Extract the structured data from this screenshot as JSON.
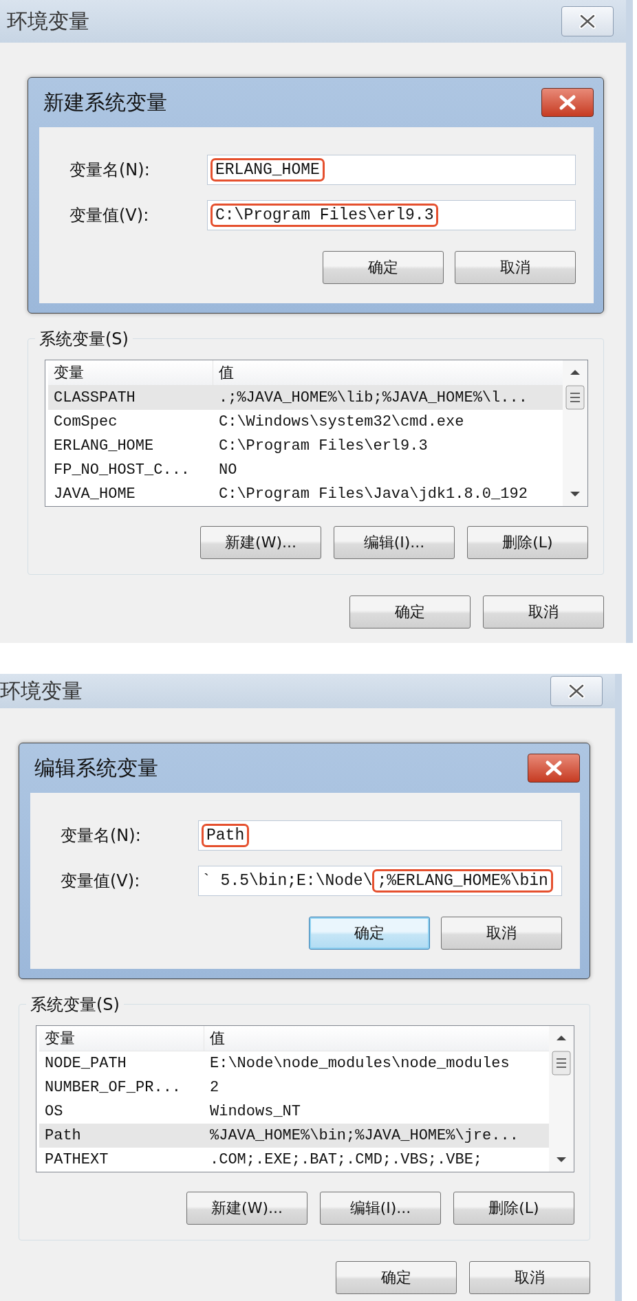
{
  "panels": [
    {
      "window": {
        "title": "环境变量"
      },
      "dialog": {
        "title": "新建系统变量",
        "fields": [
          {
            "label": "变量名(N):",
            "segments": [
              {
                "text": "ERLANG_HOME",
                "highlighted": true
              }
            ]
          },
          {
            "label": "变量值(V):",
            "segments": [
              {
                "text": "C:\\Program Files\\erl9.3",
                "highlighted": true
              }
            ]
          }
        ],
        "buttons": [
          {
            "label": "确定",
            "default": false
          },
          {
            "label": "取消",
            "default": false
          }
        ]
      },
      "system_variables": {
        "title": "系统变量(S)",
        "columns": [
          "变量",
          "值"
        ],
        "rows": [
          {
            "name": "CLASSPATH",
            "value": ".;%JAVA_HOME%\\lib;%JAVA_HOME%\\l...",
            "selected": true
          },
          {
            "name": "ComSpec",
            "value": "C:\\Windows\\system32\\cmd.exe",
            "selected": false
          },
          {
            "name": "ERLANG_HOME",
            "value": "C:\\Program Files\\erl9.3",
            "selected": false
          },
          {
            "name": "FP_NO_HOST_C...",
            "value": "NO",
            "selected": false
          },
          {
            "name": "JAVA_HOME",
            "value": "C:\\Program Files\\Java\\jdk1.8.0_192",
            "selected": false
          }
        ],
        "buttons": [
          "新建(W)...",
          "编辑(I)...",
          "删除(L)"
        ]
      },
      "buttons": [
        "确定",
        "取消"
      ]
    },
    {
      "window": {
        "title": "环境变量"
      },
      "dialog": {
        "title": "编辑系统变量",
        "fields": [
          {
            "label": "变量名(N):",
            "segments": [
              {
                "text": "Path",
                "highlighted": true
              }
            ]
          },
          {
            "label": "变量值(V):",
            "segments": [
              {
                "text": "` 5.5\\bin;E:\\Node\\",
                "highlighted": false
              },
              {
                "text": ";%ERLANG_HOME%\\bin",
                "highlighted": true
              }
            ]
          }
        ],
        "buttons": [
          {
            "label": "确定",
            "default": true
          },
          {
            "label": "取消",
            "default": false
          }
        ]
      },
      "system_variables": {
        "title": "系统变量(S)",
        "columns": [
          "变量",
          "值"
        ],
        "rows": [
          {
            "name": "NODE_PATH",
            "value": "E:\\Node\\node_modules\\node_modules",
            "selected": false
          },
          {
            "name": "NUMBER_OF_PR...",
            "value": "2",
            "selected": false
          },
          {
            "name": "OS",
            "value": "Windows_NT",
            "selected": false
          },
          {
            "name": "Path",
            "value": "%JAVA_HOME%\\bin;%JAVA_HOME%\\jre...",
            "selected": true
          },
          {
            "name": "PATHEXT",
            "value": ".COM;.EXE;.BAT;.CMD;.VBS;.VBE;",
            "selected": false
          }
        ],
        "buttons": [
          "新建(W)...",
          "编辑(I)...",
          "删除(L)"
        ]
      },
      "buttons": [
        "确定",
        "取消"
      ]
    }
  ]
}
